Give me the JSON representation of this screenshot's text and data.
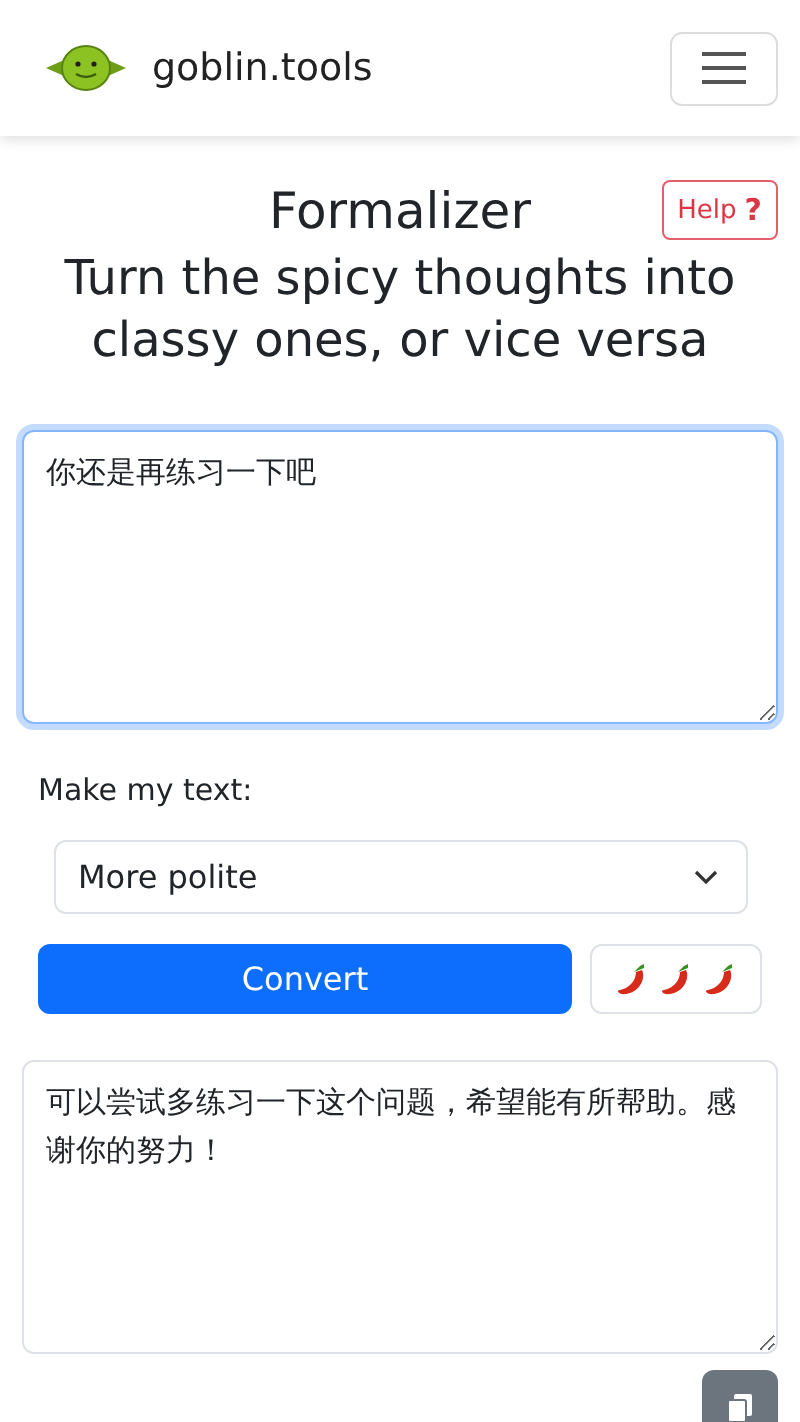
{
  "header": {
    "brand": "goblin.tools"
  },
  "title": "Formalizer",
  "help": {
    "label": "Help",
    "mark": "?"
  },
  "subtitle": "Turn the spicy thoughts into classy ones, or vice versa",
  "input": {
    "value": "你还是再练习一下吧",
    "focused": true
  },
  "mode_label": "Make my text:",
  "mode_select": {
    "value": "More polite"
  },
  "convert_button": "Convert",
  "output": {
    "value": "可以尝试多练习一下这个问题，希望能有所帮助。感谢你的努力！",
    "focused": false
  }
}
